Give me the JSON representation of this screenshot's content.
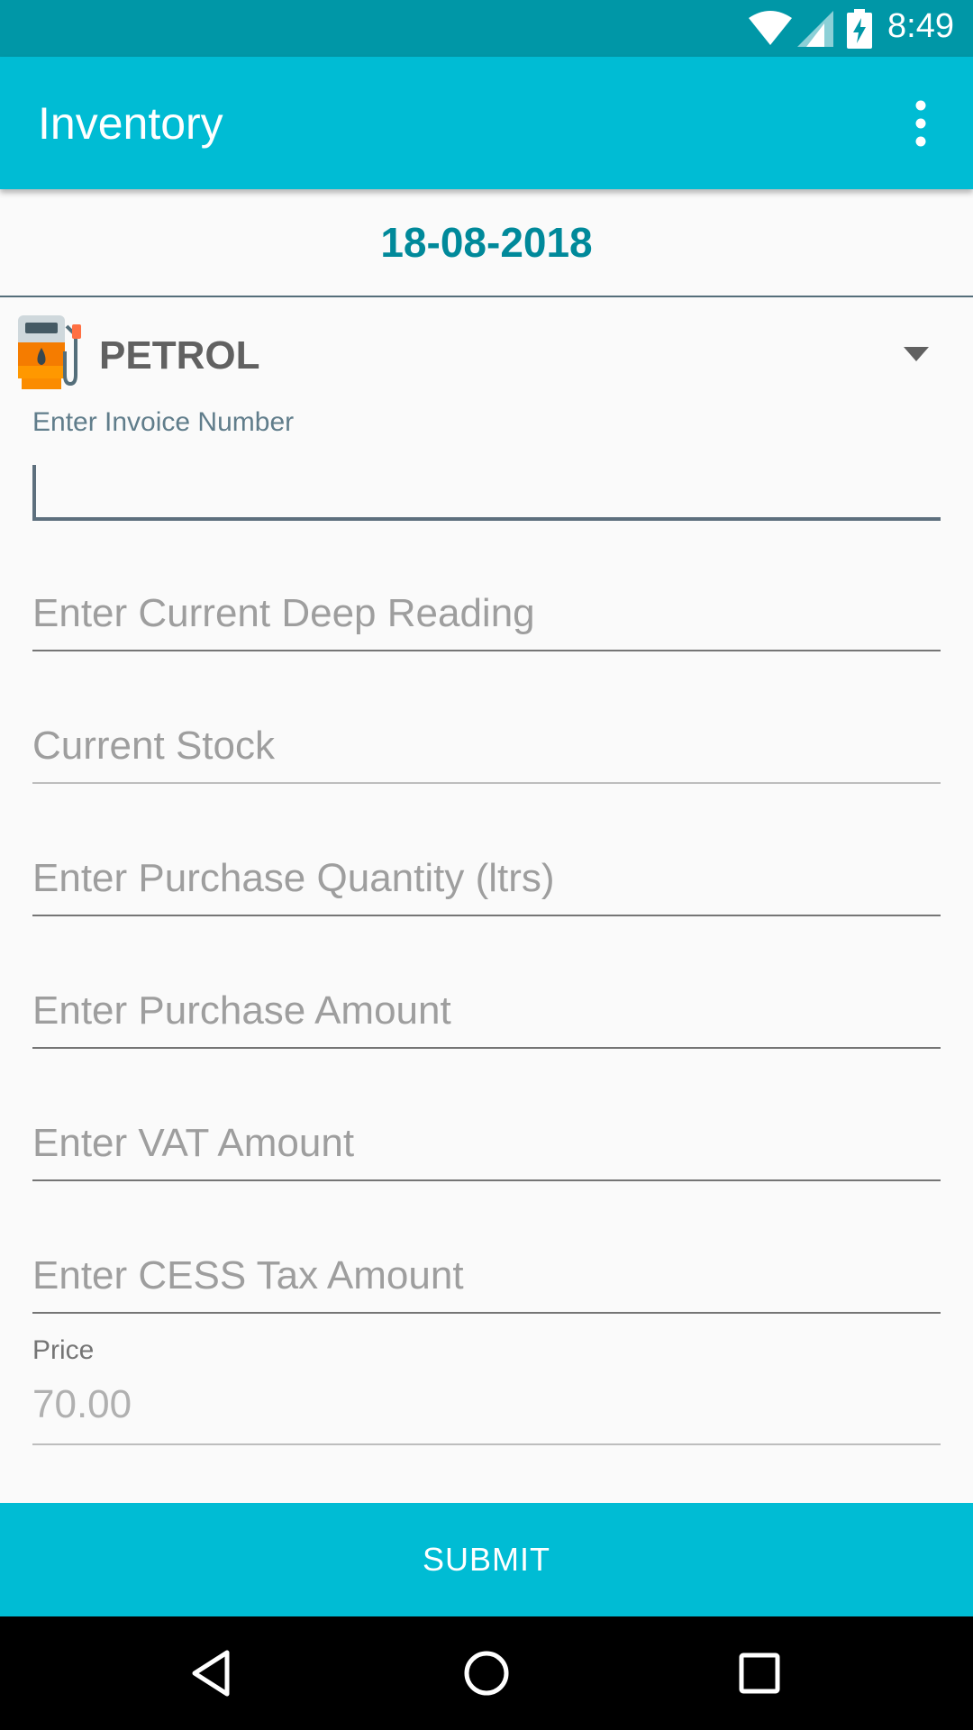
{
  "status_bar": {
    "time": "8:49",
    "icons": [
      "wifi-icon",
      "cell-signal-icon",
      "battery-charging-icon"
    ]
  },
  "app_bar": {
    "title": "Inventory",
    "overflow_icon": "more-vert-icon"
  },
  "date": "18-08-2018",
  "fuel_spinner": {
    "icon": "fuel-pump-icon",
    "selected": "PETROL",
    "dropdown_icon": "arrow-drop-down-icon"
  },
  "form": {
    "invoice_number": {
      "label": "Enter Invoice Number",
      "value": ""
    },
    "deep_reading": {
      "placeholder": "Enter Current Deep Reading"
    },
    "current_stock": {
      "placeholder": "Current Stock"
    },
    "purchase_quantity": {
      "placeholder": "Enter Purchase Quantity (ltrs)"
    },
    "purchase_amount": {
      "placeholder": "Enter Purchase Amount"
    },
    "vat_amount": {
      "placeholder": "Enter VAT Amount"
    },
    "cess_tax_amount": {
      "placeholder": "Enter CESS Tax Amount"
    },
    "price": {
      "label": "Price",
      "value": "70.00"
    }
  },
  "submit_label": "SUBMIT",
  "nav_bar": {
    "icons": [
      "back-icon",
      "home-icon",
      "recents-icon"
    ]
  },
  "colors": {
    "primary": "#00bcd4",
    "primary_dark": "#0097a7",
    "date_text": "#00899a",
    "background": "#fafafa"
  }
}
